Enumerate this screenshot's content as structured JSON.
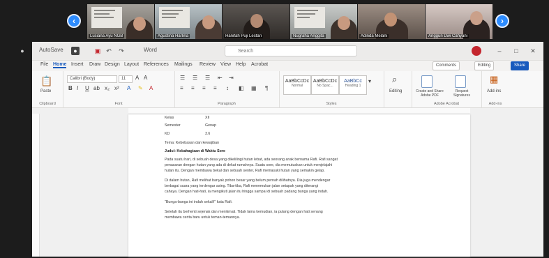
{
  "meeting": {
    "prev_icon": "arrow-left",
    "next_icon": "arrow-right",
    "participants": [
      {
        "name": "Lusiana Ayu NGB"
      },
      {
        "name": "Agustina Harlina"
      },
      {
        "name": "Hanifah Puji Lestari"
      },
      {
        "name": "Nugraha Anggita"
      },
      {
        "name": "Adinda Melani"
      },
      {
        "name": "Anggun Dwi Cahyani"
      }
    ]
  },
  "word": {
    "autosave": "AutoSave",
    "doc_title": "Word",
    "search_placeholder": "Search",
    "menu": [
      "File",
      "Home",
      "Insert",
      "Draw",
      "Design",
      "Layout",
      "References",
      "Mailings",
      "Review",
      "View",
      "Help",
      "Acrobat"
    ],
    "comments_label": "Comments",
    "editing_label": "Editing",
    "share_label": "Share",
    "ribbon": {
      "paste": "Paste",
      "font_name": "Calibri (Body)",
      "font_size": "11",
      "styles": [
        {
          "sample": "AaBbCcDc",
          "name": "Normal"
        },
        {
          "sample": "AaBbCcDc",
          "name": "No Spac..."
        },
        {
          "sample": "AaBbCc",
          "name": "Heading 1"
        }
      ],
      "editing": "Editing",
      "create_share": "Create and Share Adobe PDF",
      "request_signatures": "Request Signatures",
      "add_ins": "Add-ins",
      "groups": [
        "Clipboard",
        "Font",
        "Paragraph",
        "Styles",
        "Adobe Acrobat",
        "Add-ins"
      ]
    },
    "document": {
      "fields": [
        {
          "label": "Kelas",
          "value": "XII"
        },
        {
          "label": "Semester",
          "value": "Genap"
        },
        {
          "label": "KD",
          "value": "3.6"
        }
      ],
      "topic_line": "Tema: Kebebasan dan kewajiban",
      "heading": "Judul: Kebahagiaan di Waktu Sore",
      "paragraphs": [
        [
          "Pada suatu hari, di sebuah desa yang dikelilingi hutan lebat, ada seorang anak bernama Rafi. Rafi sangat",
          "penasaran dengan hutan yang ada di dekat rumahnya. Suatu sore, dia memutuskan untuk menjelajahi",
          "hutan itu. Dengan membawa bekal dan sebuah senter, Rafi memasuki hutan yang semakin gelap."
        ],
        [
          "Di dalam hutan, Rafi melihat banyak pohon besar yang belum pernah dilihatnya. Dia juga mendengar",
          "berbagai suara yang terdengar asing. Tiba-tiba, Rafi menemukan jalan setapak yang diterangi",
          "cahaya. Dengan hati-hati, ia mengikuti jalan itu hingga sampai di sebuah padang bunga yang indah."
        ]
      ],
      "quote_line": "\"Bunga-bunga ini indah sekali!\" kata Rafi.",
      "last_lines": [
        "Setelah itu berhenti sejenak dan menikmati. Tidak lama kemudian, ia pulang dengan hati senang",
        "membawa cerita baru untuk teman-temannya."
      ]
    }
  }
}
